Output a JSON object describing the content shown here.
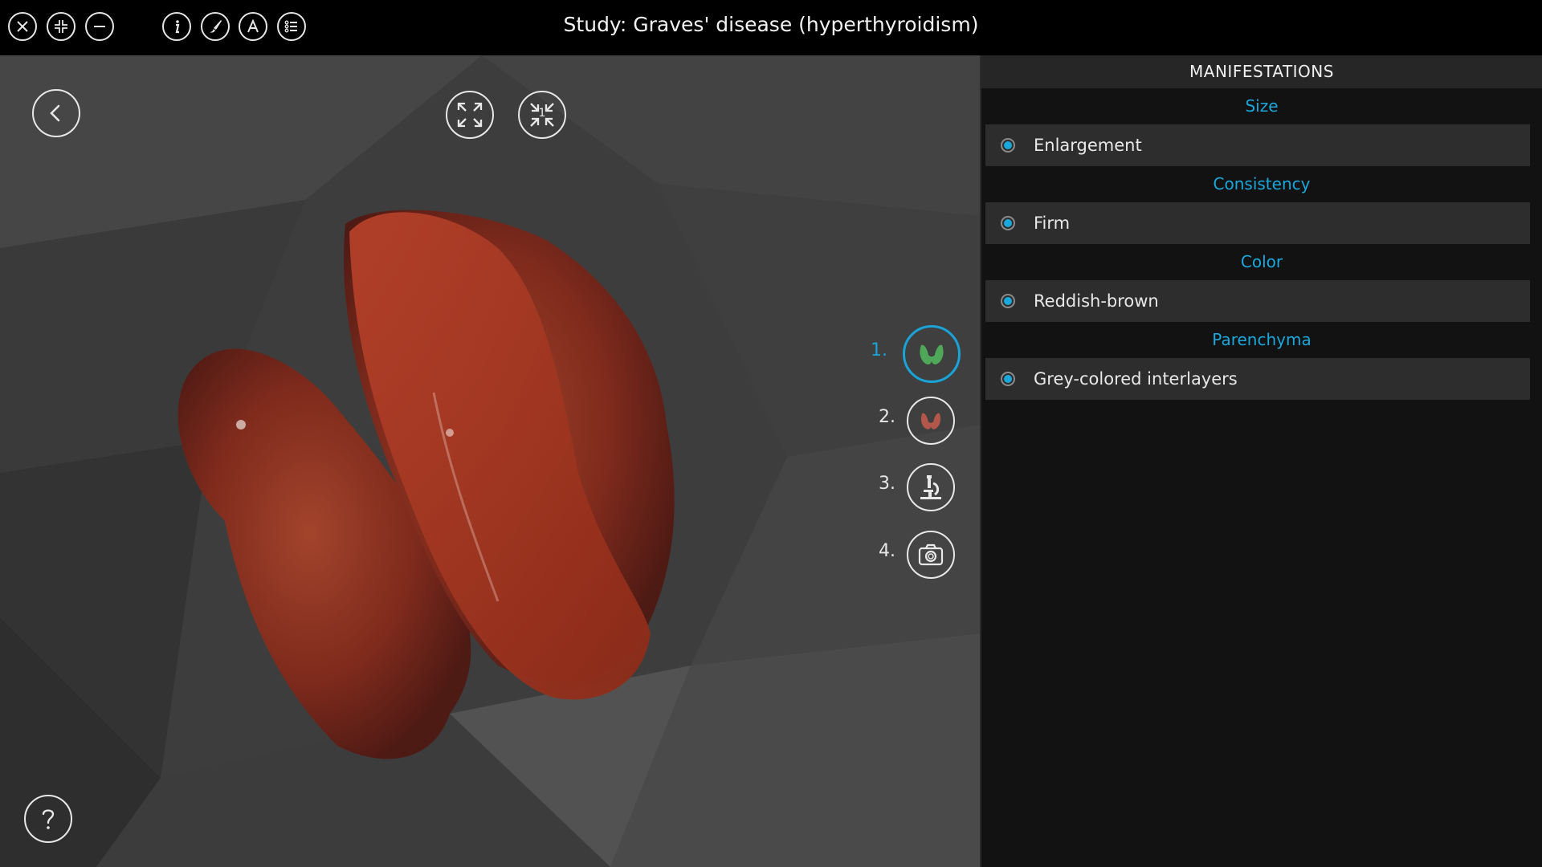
{
  "window": {
    "title": "Study: Graves' disease (hyperthyroidism)"
  },
  "toolbar": {
    "icons": [
      "close-icon",
      "restore-icon",
      "minimize-icon",
      "info-icon",
      "brush-icon",
      "font-icon",
      "list-icon"
    ]
  },
  "viewport": {
    "icons": [
      "back-icon",
      "expand-icon",
      "collapse-icon",
      "help-icon"
    ],
    "collapse_badge": "1"
  },
  "stages": [
    {
      "number": "1.",
      "icon": "thyroid-green-icon",
      "active": true
    },
    {
      "number": "2.",
      "icon": "thyroid-red-icon",
      "active": false
    },
    {
      "number": "3.",
      "icon": "microscope-icon",
      "active": false
    },
    {
      "number": "4.",
      "icon": "camera-icon",
      "active": false
    }
  ],
  "panel": {
    "header": "MANIFESTATIONS",
    "sections": [
      {
        "title": "Size",
        "item": "Enlargement"
      },
      {
        "title": "Consistency",
        "item": "Firm"
      },
      {
        "title": "Color",
        "item": "Reddish-brown"
      },
      {
        "title": "Parenchyma",
        "item": "Grey-colored interlayers"
      }
    ]
  },
  "colors": {
    "accent": "#1aa8dc",
    "organ": "#8a2a1c",
    "panel_bg": "#121212",
    "item_bg": "#2d2d2d"
  }
}
